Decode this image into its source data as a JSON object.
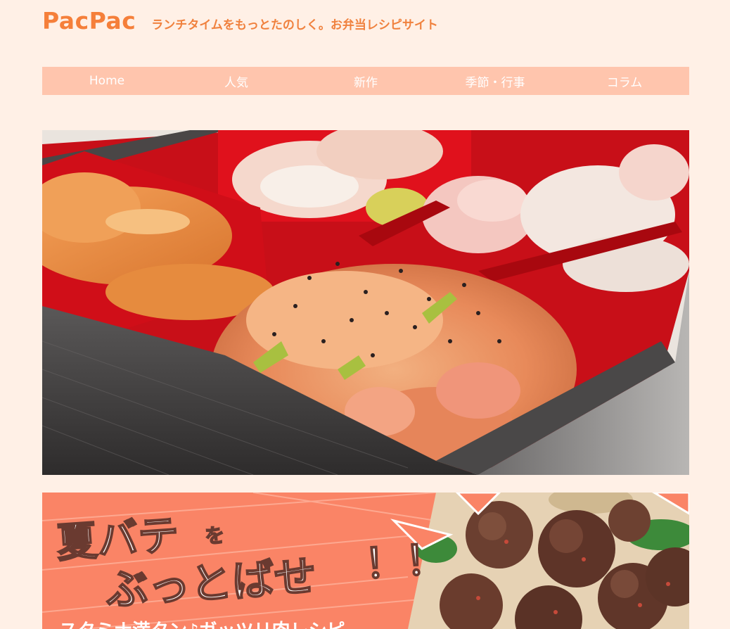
{
  "site": {
    "logo": "PacPac",
    "tagline": "ランチタイムをもっとたのしく。お弁当レシピサイト"
  },
  "nav": {
    "items": [
      {
        "label": "Home"
      },
      {
        "label": "人気"
      },
      {
        "label": "新作"
      },
      {
        "label": "季節・行事"
      },
      {
        "label": "コラム"
      }
    ]
  },
  "hero": {
    "image": "bento-box-photo"
  },
  "banner": {
    "line1_main": "夏バテ",
    "line1_particle": "を",
    "line2_main": "ぶっとばせ",
    "line2_excl": "！！",
    "subtitle": "スタミナ満タン♪ガッツリ肉レシピ"
  },
  "colors": {
    "background": "#fff0e6",
    "accent": "#f57f3a",
    "nav_bg": "#ffc5ad",
    "banner_bg": "#fa8466"
  }
}
